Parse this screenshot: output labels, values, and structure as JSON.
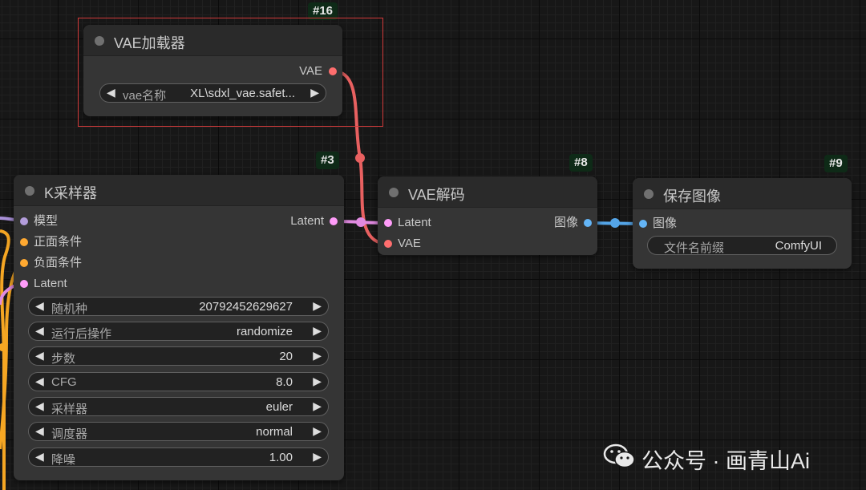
{
  "colors": {
    "model_port": "#b39ddb",
    "conditioning_port": "#ffa931",
    "latent_port": "#ff9cf9",
    "vae_port": "#ff6e6e",
    "image_port": "#64b5f6",
    "node_id_bg": "#0e2a17",
    "selection": "#d23a3a"
  },
  "vae_loader": {
    "id": "#16",
    "title": "VAE加载器",
    "output": "VAE",
    "widget": {
      "label": "vae名称",
      "value": "XL\\sdxl_vae.safet..."
    }
  },
  "ksampler": {
    "id": "#3",
    "title": "K采样器",
    "inputs": [
      "模型",
      "正面条件",
      "负面条件",
      "Latent"
    ],
    "output": "Latent",
    "widgets": [
      {
        "label": "随机种",
        "value": "20792452629627"
      },
      {
        "label": "运行后操作",
        "value": "randomize"
      },
      {
        "label": "步数",
        "value": "20"
      },
      {
        "label": "CFG",
        "value": "8.0"
      },
      {
        "label": "采样器",
        "value": "euler"
      },
      {
        "label": "调度器",
        "value": "normal"
      },
      {
        "label": "降噪",
        "value": "1.00"
      }
    ]
  },
  "vae_decode": {
    "id": "#8",
    "title": "VAE解码",
    "inputs": [
      "Latent",
      "VAE"
    ],
    "output": "图像"
  },
  "save_image": {
    "id": "#9",
    "title": "保存图像",
    "input": "图像",
    "widget": {
      "label": "文件名前缀",
      "value": "ComfyUI"
    }
  },
  "watermark": {
    "text": "公众号 · 画青山Ai",
    "icon": "wechat-icon"
  },
  "icons": {
    "left_arrow": "◀",
    "right_arrow": "▶"
  }
}
